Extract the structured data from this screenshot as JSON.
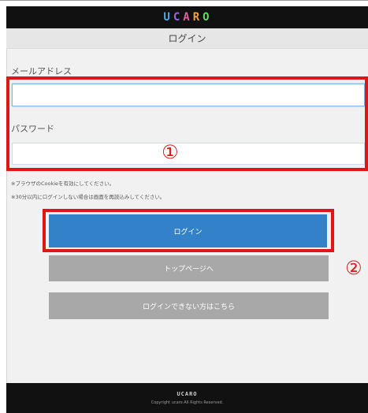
{
  "header": {
    "logo_letters": [
      {
        "char": "U",
        "color": "#4aa8e8"
      },
      {
        "char": "C",
        "color": "#9b6ad8"
      },
      {
        "char": "A",
        "color": "#e85a9a"
      },
      {
        "char": "R",
        "color": "#f0a040"
      },
      {
        "char": "O",
        "color": "#6ad86a"
      }
    ],
    "title": "ログイン"
  },
  "form": {
    "email_label": "メールアドレス",
    "email_value": "",
    "password_label": "パスワード",
    "password_value": ""
  },
  "annotations": {
    "marker_1": "①",
    "marker_2": "②",
    "highlight_color": "#e01515"
  },
  "notes": [
    "※ブラウザのCookieを有効にしてください。",
    "※30分以内にログインしない場合は画面を再読込みしてください。"
  ],
  "buttons": {
    "login": "ログイン",
    "top_page": "トップページへ",
    "cannot_login": "ログインできない方はこちら"
  },
  "footer": {
    "logo": "UCARO",
    "copyright": "Copyright ucaro All Rights Reserved."
  },
  "colors": {
    "primary": "#3381c8",
    "gray_button": "#a8a8a8",
    "header_bg": "#111111"
  }
}
